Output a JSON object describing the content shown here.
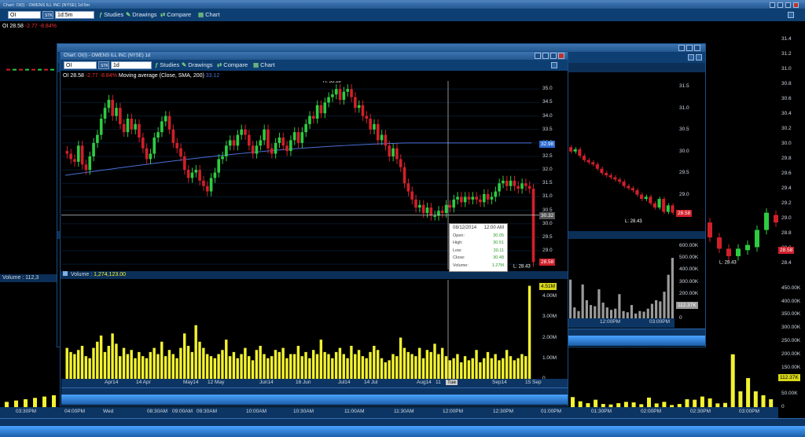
{
  "bg_window": {
    "title": "Chart: OI(I) - OWENS ILL INC (NYSE) 1d:5m",
    "symbol": "OI",
    "interval": "1d:5m",
    "toolbar": {
      "studies": "Studies",
      "drawings": "Drawings",
      "compare": "Compare",
      "chart": "Chart",
      "studies_icon": "function-icon",
      "drawings_icon": "pencil-icon",
      "compare_icon": "compare-icon",
      "chart_icon": "chart-icon"
    },
    "info": {
      "symbol": "OI",
      "last": "28.58",
      "change": "-2.77",
      "change_pct": "-8.84%"
    },
    "y_axis": [
      "31.4",
      "31.2",
      "31.0",
      "30.8",
      "30.6",
      "30.4",
      "30.2",
      "30.0",
      "29.8",
      "29.6",
      "29.4",
      "29.2",
      "29.0",
      "28.8",
      "28.6",
      "28.4"
    ],
    "price_tag": "28.58",
    "low_tag": "L: 28.43",
    "volume_label": "Volume : 112,3",
    "volume_axis": [
      "450.00K",
      "400.00K",
      "350.00K",
      "300.00K",
      "250.00K",
      "200.00K",
      "150.00K",
      "100.00K",
      "50.00K",
      "0"
    ],
    "volume_tag": "112.37K",
    "volume_values": [
      38,
      22,
      15,
      28,
      12,
      10,
      15,
      20,
      18,
      11,
      36,
      14,
      20,
      8,
      12,
      30,
      28,
      40,
      33,
      14,
      16,
      200,
      60,
      110,
      60,
      45,
      30
    ],
    "time_labels": [
      "03:30PM",
      "04:00PM",
      "Wed",
      "08:30AM",
      "09:00AM",
      "09:30AM",
      "10:00AM",
      "10:30AM",
      "11:00AM",
      "11:30AM",
      "12:00PM",
      "12:30PM",
      "01:00PM",
      "01:30PM",
      "02:00PM",
      "02:30PM",
      "03:00PM"
    ]
  },
  "mid_window": {
    "y_axis": [
      "31.5",
      "31.0",
      "30.5",
      "30.0",
      "29.5",
      "29.0",
      "28.5"
    ],
    "price_tag": "28.58",
    "low_tag": "L: 28.43",
    "volume_axis": [
      "600.00K",
      "500.00K",
      "400.00K",
      "300.00K",
      "200.00K",
      "100.00K",
      "0"
    ],
    "volume_tag": "112.37K",
    "volume_values": [
      320,
      90,
      60,
      280,
      150,
      110,
      100,
      240,
      130,
      90,
      70,
      80,
      200,
      60,
      50,
      110,
      40,
      60,
      55,
      80,
      120,
      150,
      140,
      220,
      360,
      500
    ],
    "time_labels": [
      "12:00PM",
      "03:00PM"
    ]
  },
  "front_window": {
    "title": "Chart: OI(I) - OWENS ILL INC (NYSE) 1d",
    "symbol": "OI",
    "interval": "1d",
    "toolbar": {
      "studies": "Studies",
      "drawings": "Drawings",
      "compare": "Compare",
      "chart": "Chart",
      "studies_icon": "function-icon",
      "drawings_icon": "pencil-icon",
      "compare_icon": "compare-icon",
      "chart_icon": "chart-icon"
    },
    "info": {
      "symbol": "OI",
      "last": "28.58",
      "change": "-2.77",
      "change_pct": "-8.84%",
      "study": "Moving average (Close, SMA, 200)",
      "study_value": "33.12"
    },
    "y_axis": [
      "35.0",
      "34.5",
      "34.0",
      "33.5",
      "33.0",
      "32.5",
      "32.0",
      "31.5",
      "31.0",
      "30.5",
      "30.0",
      "29.5",
      "29.0",
      "28.5"
    ],
    "high_tag": "H: 35.18",
    "low_tag": "L: 28.43",
    "price_tag": "28.58",
    "ma_tag": "32.98",
    "cross_tag": "30.32",
    "tooltip": {
      "date": "08/12/2014",
      "time": "12:00 AM",
      "open_label": "Open:",
      "open": "30.05",
      "high_label": "High:",
      "high": "30.51",
      "low_label": "Low:",
      "low": "30.11",
      "close_label": "Close:",
      "close": "30.48",
      "volume_label": "Volume:",
      "volume": "1.27M"
    },
    "volume_label": "Volume",
    "volume_value": "1,274,123.00",
    "volume_axis": [
      "4.00M",
      "3.00M",
      "2.00M",
      "1.00M",
      "0"
    ],
    "volume_tag": "4.51M",
    "x_labels": [
      "Apr14",
      "14 Apr",
      "May14",
      "12 May",
      "Jun14",
      "16 Jun",
      "Jul14",
      "14 Jul",
      "Aug14",
      "11",
      "Tue",
      "Sep14",
      "15 Sep"
    ],
    "closes": [
      32.6,
      32.4,
      32.3,
      32.9,
      32.2,
      32.0,
      32.5,
      33.0,
      33.3,
      33.9,
      34.3,
      34.6,
      34.0,
      34.3,
      33.7,
      33.4,
      33.9,
      33.5,
      33.7,
      33.2,
      32.8,
      32.4,
      32.6,
      33.2,
      33.4,
      33.8,
      34.0,
      33.5,
      33.0,
      32.8,
      32.5,
      32.0,
      31.7,
      31.9,
      32.0,
      31.6,
      31.4,
      31.2,
      31.7,
      31.9,
      32.4,
      32.5,
      32.9,
      33.1,
      32.9,
      33.3,
      33.5,
      33.3,
      32.9,
      32.6,
      32.9,
      33.1,
      33.5,
      32.8,
      32.6,
      33.0,
      33.2,
      32.9,
      32.7,
      33.1,
      33.4,
      33.0,
      33.4,
      33.7,
      34.0,
      33.9,
      34.4,
      34.1,
      34.5,
      34.7,
      34.8,
      35.0,
      34.6,
      34.9,
      35.0,
      34.7,
      34.3,
      34.4,
      34.0,
      33.9,
      33.5,
      33.7,
      33.1,
      33.3,
      32.9,
      32.5,
      32.8,
      32.4,
      32.1,
      31.5,
      31.2,
      30.9,
      30.6,
      30.7,
      30.4,
      30.6,
      30.3,
      30.3,
      30.48,
      30.4,
      30.7,
      30.6,
      30.9,
      31.0,
      30.8,
      31.0,
      30.9,
      31.0,
      30.9,
      30.8,
      31.1,
      30.9,
      31.0,
      31.2,
      31.5,
      31.6,
      31.4,
      31.6,
      31.4,
      31.3,
      31.5,
      31.4,
      31.3,
      28.58
    ],
    "volumes": [
      1.5,
      1.3,
      1.2,
      1.4,
      1.6,
      1.1,
      1.0,
      1.5,
      1.8,
      2.1,
      1.3,
      1.6,
      2.2,
      1.7,
      1.1,
      1.5,
      1.2,
      1.4,
      1.0,
      1.3,
      1.1,
      1.0,
      1.3,
      1.5,
      1.2,
      1.8,
      1.1,
      1.4,
      1.2,
      1.0,
      1.5,
      2.2,
      1.6,
      1.3,
      2.6,
      1.8,
      1.5,
      1.2,
      1.1,
      1.0,
      1.2,
      1.4,
      1.9,
      1.1,
      1.3,
      1.0,
      1.2,
      1.5,
      1.1,
      0.9,
      1.4,
      1.6,
      1.2,
      1.0,
      1.1,
      1.4,
      1.3,
      1.5,
      1.0,
      1.2,
      1.2,
      1.6,
      1.1,
      1.3,
      1.0,
      1.4,
      1.2,
      1.9,
      1.3,
      1.2,
      1.0,
      1.3,
      1.5,
      1.2,
      1.0,
      1.6,
      1.2,
      1.4,
      1.1,
      1.0,
      1.3,
      1.6,
      1.4,
      1.0,
      0.8,
      0.9,
      1.2,
      1.1,
      2.0,
      1.5,
      1.3,
      1.2,
      1.1,
      1.5,
      1.0,
      1.4,
      1.3,
      1.7,
      1.2,
      1.5,
      1.1,
      0.9,
      1.0,
      1.2,
      0.8,
      1.1,
      0.9,
      1.0,
      1.4,
      0.8,
      1.0,
      1.3,
      1.0,
      1.2,
      0.9,
      1.0,
      1.4,
      1.1,
      0.9,
      1.0,
      1.2,
      1.1,
      4.51
    ]
  },
  "colors": {
    "up": "#2ecc40",
    "down": "#d0202a",
    "volume": "#f2f230",
    "ma": "#4a6fd8",
    "frame": "#1a4f86",
    "tag_red": "#d0202a",
    "tag_blue": "#2a6ad0"
  }
}
